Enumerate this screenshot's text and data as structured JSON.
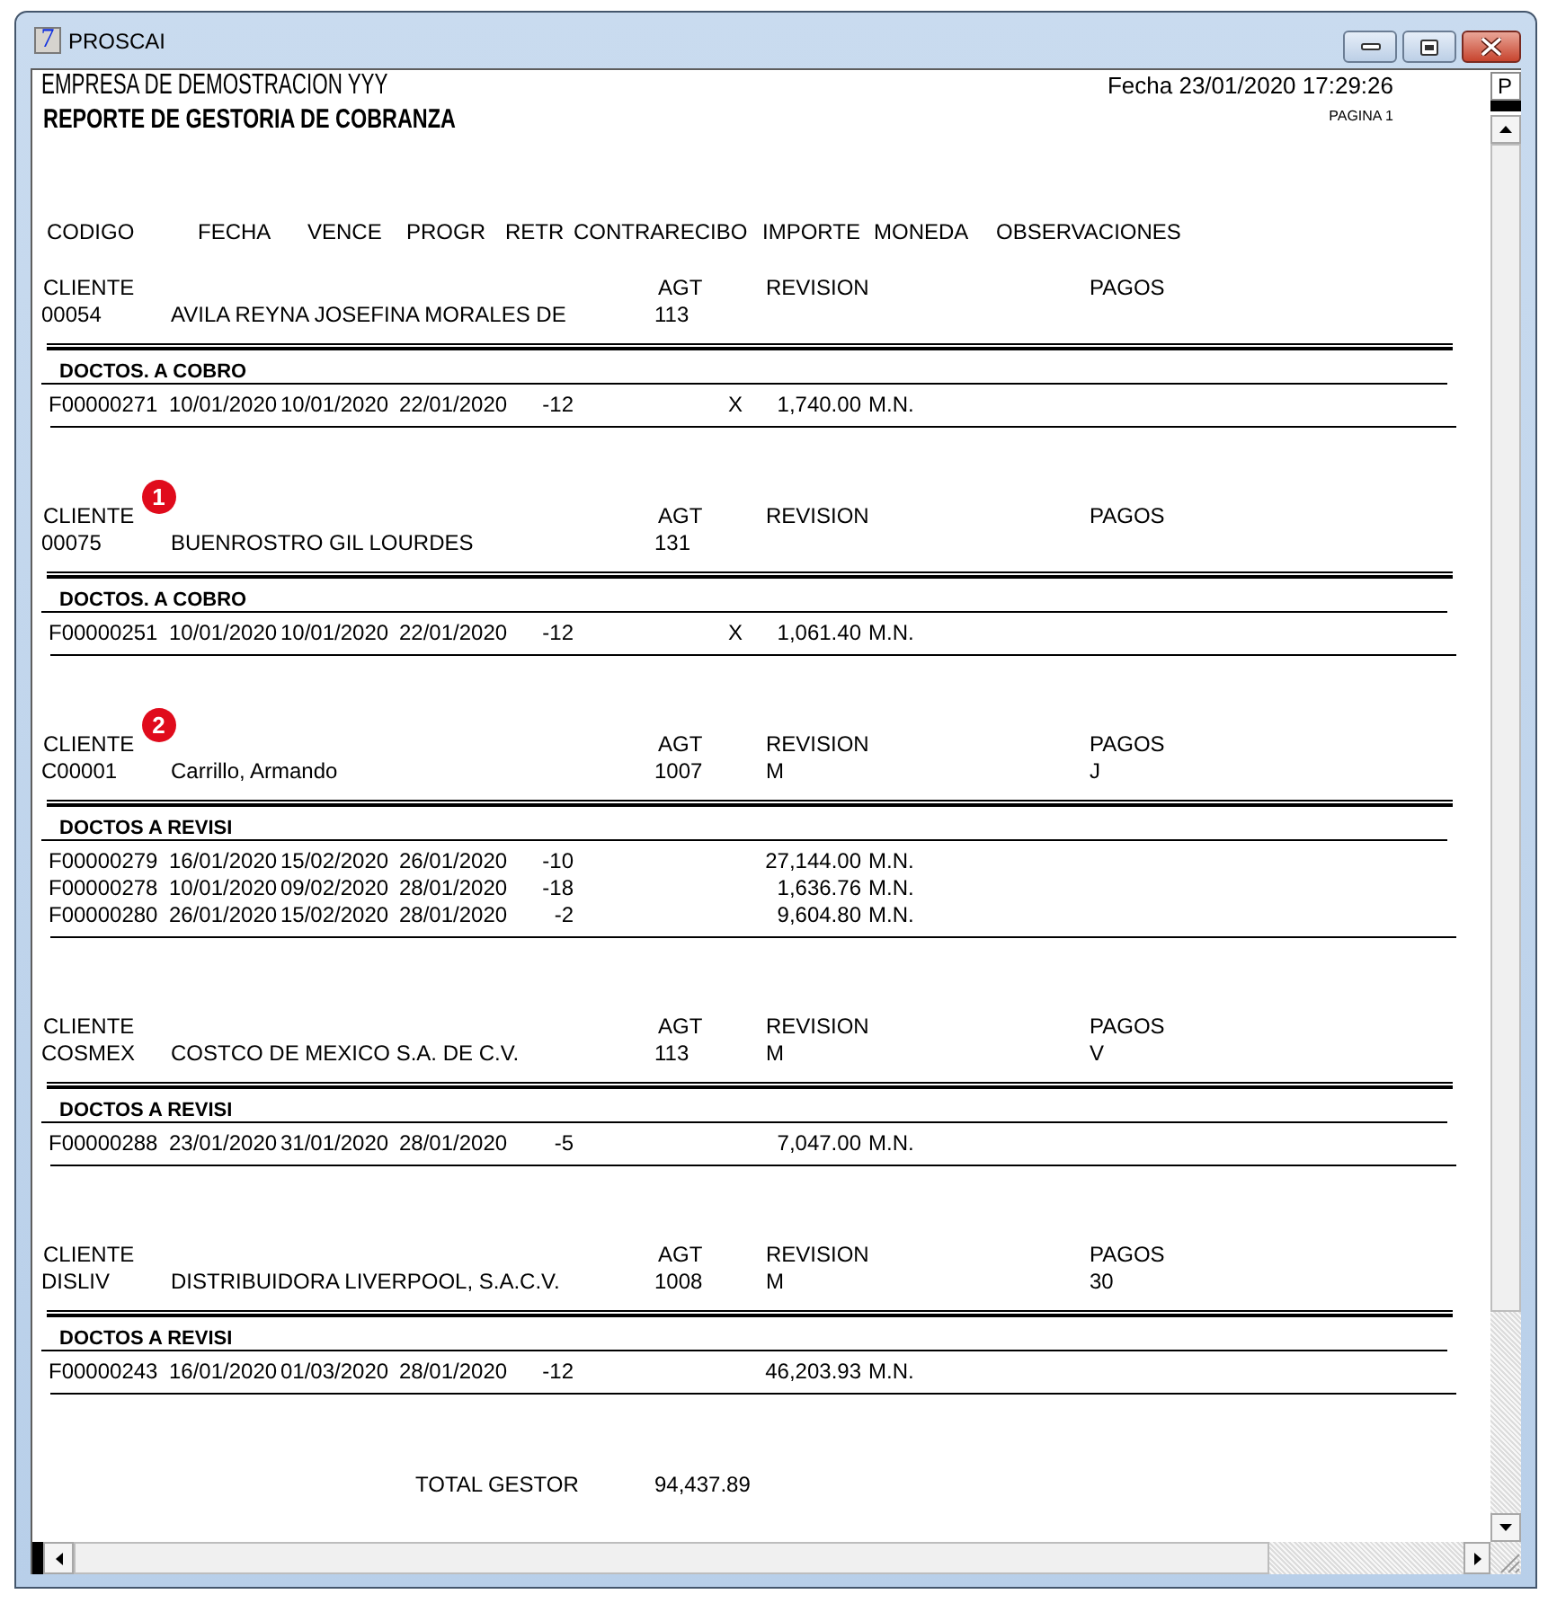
{
  "window": {
    "title": "PROSCAI",
    "app_icon": "7"
  },
  "report": {
    "company": "EMPRESA DE DEMOSTRACION YYY",
    "title": "REPORTE DE GESTORIA DE COBRANZA",
    "date": "Fecha 23/01/2020 17:29:26",
    "page": "PAGINA 1",
    "columns": [
      "CODIGO",
      "FECHA",
      "VENCE",
      "PROGR",
      "RETR",
      "CONTRARECIBO",
      "IMPORTE",
      "MONEDA",
      "OBSERVACIONES"
    ],
    "clients": [
      {
        "header": {
          "cliente": "CLIENTE",
          "agt": "AGT",
          "revision": "REVISION",
          "pagos": "PAGOS"
        },
        "code": "00054",
        "name": "AVILA REYNA JOSEFINA MORALES DE",
        "agt": "113",
        "section": "DOCTOS. A COBRO",
        "docs": [
          {
            "folio": "F00000271",
            "fecha": "10/01/2020",
            "vence": "10/01/2020",
            "progr": "22/01/2020",
            "retr": "-12",
            "contrarecibo": "X",
            "importe": "1,740.00",
            "moneda": "M.N."
          }
        ]
      },
      {
        "header": {
          "cliente": "CLIENTE",
          "agt": "AGT",
          "revision": "REVISION",
          "pagos": "PAGOS"
        },
        "badge": "1",
        "code": "00075",
        "name": "BUENROSTRO GIL LOURDES",
        "agt": "131",
        "section": "DOCTOS. A COBRO",
        "docs": [
          {
            "folio": "F00000251",
            "fecha": "10/01/2020",
            "vence": "10/01/2020",
            "progr": "22/01/2020",
            "retr": "-12",
            "contrarecibo": "X",
            "importe": "1,061.40",
            "moneda": "M.N."
          }
        ]
      },
      {
        "header": {
          "cliente": "CLIENTE",
          "agt": "AGT",
          "revision": "REVISION",
          "pagos": "PAGOS"
        },
        "badge": "2",
        "code": "C00001",
        "name": "Carrillo, Armando",
        "agt": "1007",
        "revision": "M",
        "pagos": "J",
        "section": "DOCTOS A REVISI",
        "docs": [
          {
            "folio": "F00000279",
            "fecha": "16/01/2020",
            "vence": "15/02/2020",
            "progr": "26/01/2020",
            "retr": "-10",
            "importe": "27,144.00",
            "moneda": "M.N."
          },
          {
            "folio": "F00000278",
            "fecha": "10/01/2020",
            "vence": "09/02/2020",
            "progr": "28/01/2020",
            "retr": "-18",
            "importe": "1,636.76",
            "moneda": "M.N."
          },
          {
            "folio": "F00000280",
            "fecha": "26/01/2020",
            "vence": "15/02/2020",
            "progr": "28/01/2020",
            "retr": "-2",
            "importe": "9,604.80",
            "moneda": "M.N."
          }
        ]
      },
      {
        "header": {
          "cliente": "CLIENTE",
          "agt": "AGT",
          "revision": "REVISION",
          "pagos": "PAGOS"
        },
        "code": "COSMEX",
        "name": "COSTCO DE MEXICO S.A. DE C.V.",
        "agt": "113",
        "revision": "M",
        "pagos": "V",
        "section": "DOCTOS A REVISI",
        "docs": [
          {
            "folio": "F00000288",
            "fecha": "23/01/2020",
            "vence": "31/01/2020",
            "progr": "28/01/2020",
            "retr": "-5",
            "importe": "7,047.00",
            "moneda": "M.N."
          }
        ]
      },
      {
        "header": {
          "cliente": "CLIENTE",
          "agt": "AGT",
          "revision": "REVISION",
          "pagos": "PAGOS"
        },
        "code": "DISLIV",
        "name": "DISTRIBUIDORA LIVERPOOL, S.A.C.V.",
        "agt": "1008",
        "revision": "M",
        "pagos": "30",
        "section": "DOCTOS A REVISI",
        "docs": [
          {
            "folio": "F00000243",
            "fecha": "16/01/2020",
            "vence": "01/03/2020",
            "progr": "28/01/2020",
            "retr": "-12",
            "importe": "46,203.93",
            "moneda": "M.N."
          }
        ]
      }
    ],
    "total": {
      "label": "TOTAL GESTOR",
      "value": "94,437.89"
    }
  },
  "vertical_scrollbar": {
    "label": "P"
  }
}
